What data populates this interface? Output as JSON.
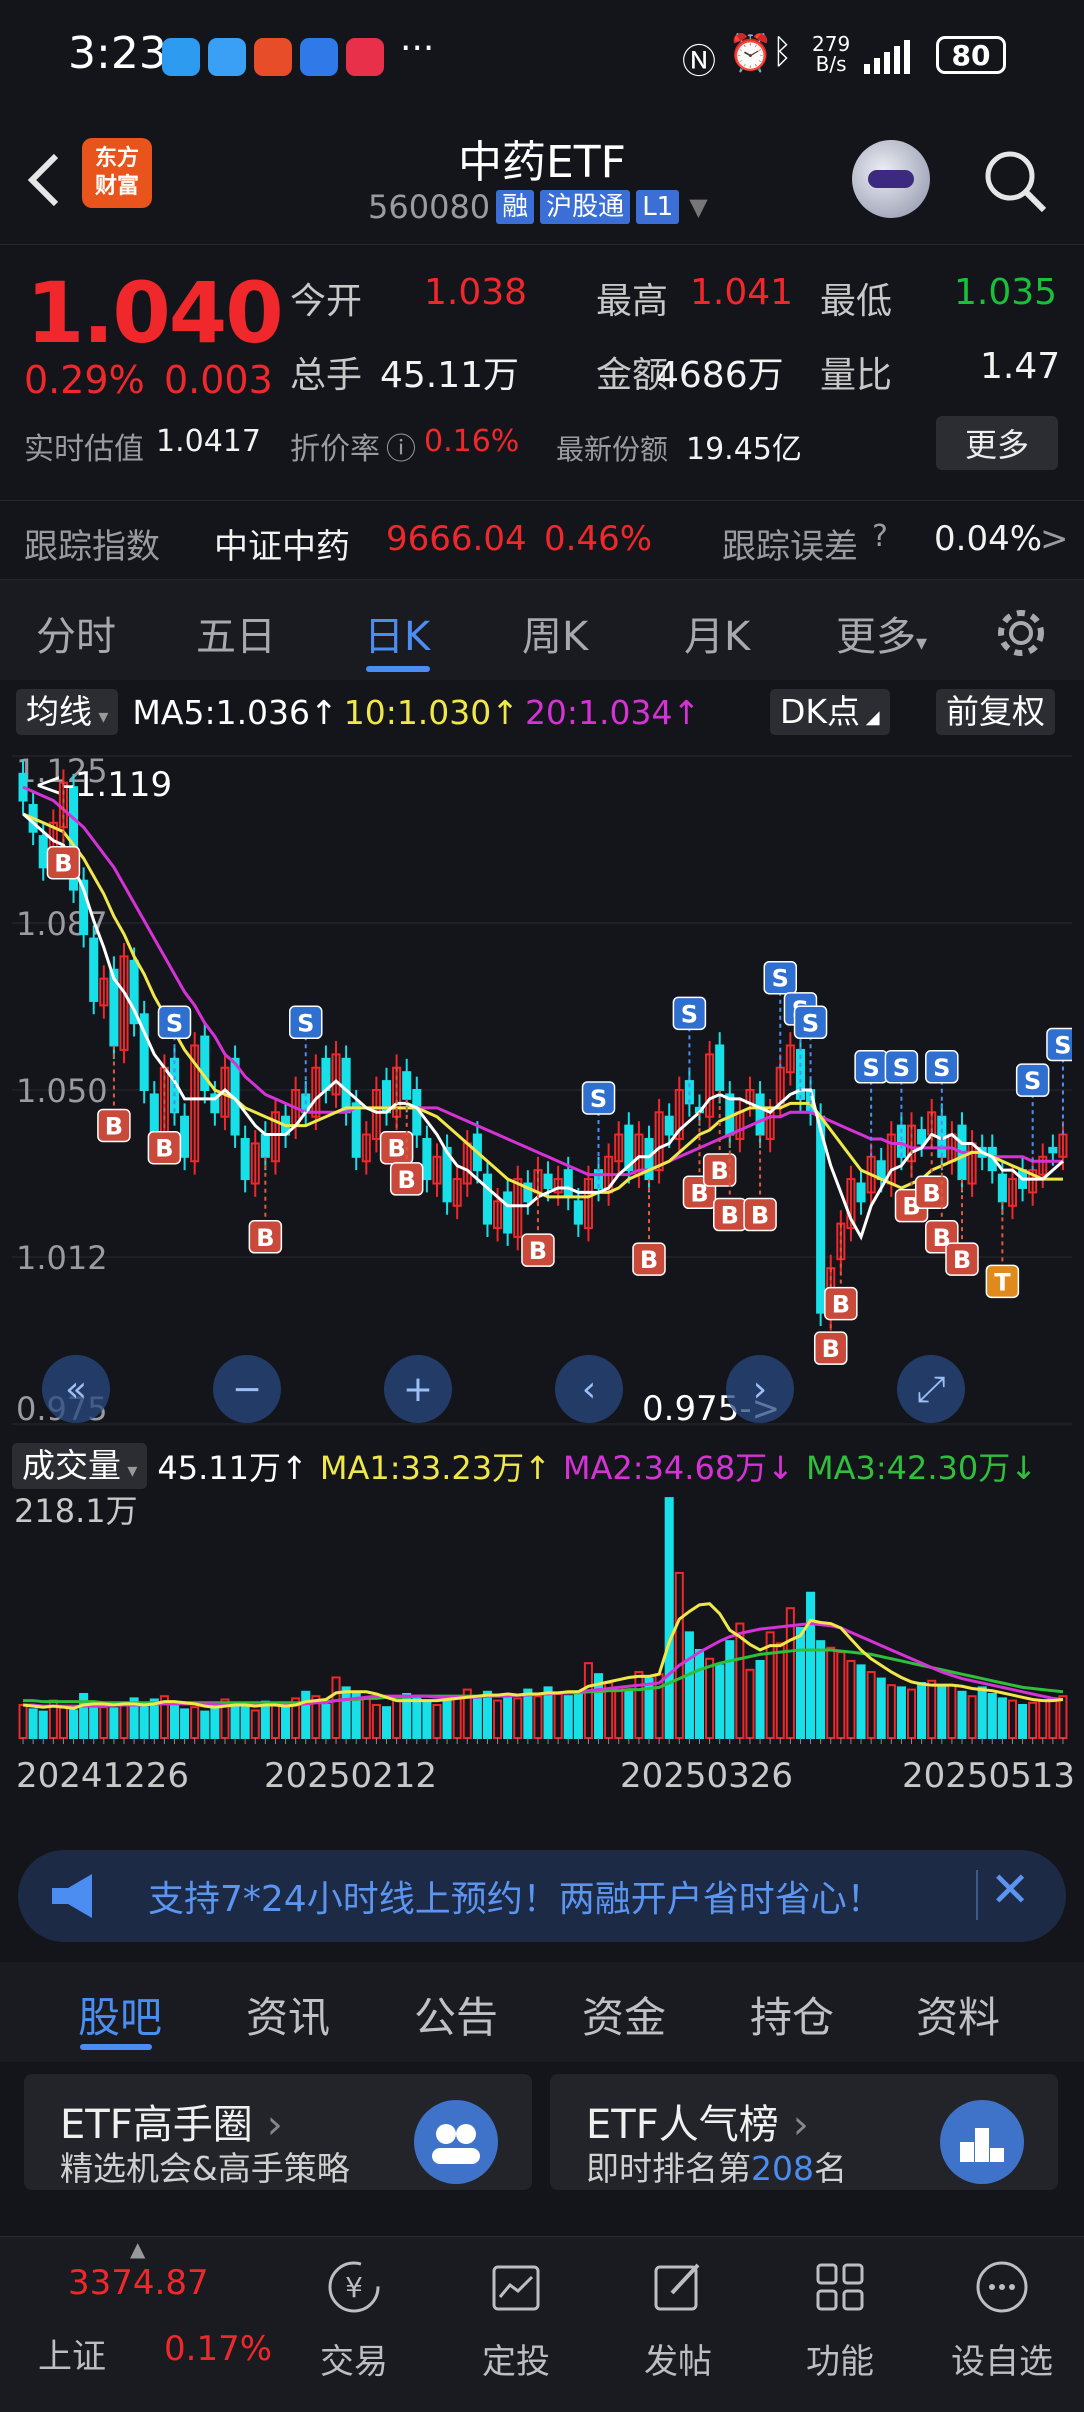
{
  "status_bar": {
    "time": "3:23",
    "net_speed_value": "279",
    "net_speed_unit": "B/s",
    "battery": "80"
  },
  "header": {
    "logo_line1": "东方",
    "logo_line2": "财富",
    "title": "中药ETF",
    "code": "560080",
    "tags": [
      "融",
      "沪股通",
      "L1"
    ]
  },
  "quote": {
    "price": "1.040",
    "change_pct": "0.29%",
    "change": "0.003",
    "open_label": "今开",
    "open": "1.038",
    "high_label": "最高",
    "high": "1.041",
    "low_label": "最低",
    "low": "1.035",
    "volume_label": "总手",
    "volume": "45.11万",
    "amount_label": "金额",
    "amount": "4686万",
    "ratio_label": "量比",
    "ratio": "1.47",
    "iopv_label": "实时估值",
    "iopv": "1.0417",
    "discount_label": "折价率",
    "discount": "0.16%",
    "shares_label": "最新份额",
    "shares": "19.45亿",
    "more_label": "更多"
  },
  "tracking": {
    "index_label": "跟踪指数",
    "index_name": "中证中药",
    "index_value": "9666.04",
    "index_change": "0.46%",
    "error_label": "跟踪误差",
    "error_value": "0.04%"
  },
  "kline_tabs": [
    "分时",
    "五日",
    "日K",
    "周K",
    "月K",
    "更多"
  ],
  "ma_row": {
    "selector": "均线",
    "ma5": "MA5:1.036↑",
    "ma10": "10:1.030↑",
    "ma20": "20:1.034↑",
    "dk_label": "DK点",
    "adjust_label": "前复权"
  },
  "vol_row": {
    "selector": "成交量",
    "vol": "45.11万↑",
    "ma1": "MA1:33.23万↑",
    "ma2": "MA2:34.68万↓",
    "ma3": "MA3:42.30万↓"
  },
  "chart_data": [
    {
      "type": "candlestick",
      "y_ticks": [
        "1.125",
        "1.087",
        "1.050",
        "1.012",
        "0.975"
      ],
      "ylim": [
        0.975,
        1.125
      ],
      "annotations": [
        "<-1.119",
        "0.975->"
      ],
      "x_ticks": [
        "20241226",
        "20250212",
        "20250326",
        "20250513"
      ],
      "close": [
        1.115,
        1.108,
        1.1,
        1.11,
        1.119,
        1.095,
        1.085,
        1.07,
        1.075,
        1.06,
        1.08,
        1.065,
        1.05,
        1.04,
        1.055,
        1.045,
        1.035,
        1.06,
        1.05,
        1.045,
        1.055,
        1.04,
        1.03,
        1.038,
        1.035,
        1.045,
        1.04,
        1.05,
        1.045,
        1.055,
        1.05,
        1.058,
        1.045,
        1.035,
        1.04,
        1.05,
        1.045,
        1.055,
        1.048,
        1.04,
        1.03,
        1.035,
        1.025,
        1.03,
        1.038,
        1.032,
        1.02,
        1.025,
        1.018,
        1.03,
        1.025,
        1.032,
        1.028,
        1.03,
        1.026,
        1.02,
        1.03,
        1.028,
        1.035,
        1.04,
        1.032,
        1.04,
        1.03,
        1.045,
        1.04,
        1.05,
        1.047,
        1.045,
        1.058,
        1.05,
        1.04,
        1.045,
        1.05,
        1.04,
        1.045,
        1.055,
        1.06,
        1.048,
        1.045,
        1.0,
        1.01,
        1.02,
        1.03,
        1.025,
        1.035,
        1.03,
        1.04,
        1.035,
        1.042,
        1.038,
        1.045,
        1.035,
        1.04,
        1.03,
        1.038,
        1.035,
        1.032,
        1.025,
        1.03,
        1.028,
        1.032,
        1.035,
        1.036,
        1.04
      ],
      "ma5": [
        1.112,
        1.11,
        1.108,
        1.106,
        1.105,
        1.1,
        1.095,
        1.088,
        1.082,
        1.075,
        1.072,
        1.068,
        1.063,
        1.058,
        1.055,
        1.052,
        1.048,
        1.048,
        1.048,
        1.048,
        1.05,
        1.048,
        1.045,
        1.042,
        1.04,
        1.04,
        1.04,
        1.042,
        1.045,
        1.048,
        1.05,
        1.052,
        1.05,
        1.048,
        1.046,
        1.045,
        1.045,
        1.047,
        1.047,
        1.046,
        1.043,
        1.04,
        1.036,
        1.033,
        1.032,
        1.03,
        1.028,
        1.026,
        1.024,
        1.024,
        1.024,
        1.026,
        1.027,
        1.028,
        1.028,
        1.027,
        1.027,
        1.027,
        1.028,
        1.031,
        1.033,
        1.035,
        1.035,
        1.037,
        1.038,
        1.041,
        1.043,
        1.045,
        1.048,
        1.049,
        1.048,
        1.048,
        1.047,
        1.046,
        1.045,
        1.047,
        1.049,
        1.05,
        1.05,
        1.041,
        1.033,
        1.027,
        1.021,
        1.017,
        1.024,
        1.028,
        1.032,
        1.033,
        1.036,
        1.037,
        1.04,
        1.039,
        1.04,
        1.038,
        1.038,
        1.036,
        1.035,
        1.032,
        1.032,
        1.03,
        1.03,
        1.03,
        1.032,
        1.034
      ],
      "ma10": [
        1.112,
        1.111,
        1.11,
        1.109,
        1.108,
        1.105,
        1.102,
        1.098,
        1.094,
        1.089,
        1.085,
        1.08,
        1.076,
        1.071,
        1.067,
        1.063,
        1.059,
        1.056,
        1.053,
        1.05,
        1.049,
        1.048,
        1.046,
        1.045,
        1.044,
        1.043,
        1.042,
        1.042,
        1.042,
        1.043,
        1.044,
        1.045,
        1.046,
        1.046,
        1.046,
        1.046,
        1.046,
        1.046,
        1.046,
        1.046,
        1.045,
        1.044,
        1.042,
        1.04,
        1.038,
        1.036,
        1.034,
        1.032,
        1.03,
        1.029,
        1.028,
        1.027,
        1.026,
        1.026,
        1.026,
        1.026,
        1.026,
        1.027,
        1.027,
        1.028,
        1.03,
        1.031,
        1.032,
        1.033,
        1.034,
        1.036,
        1.038,
        1.04,
        1.041,
        1.043,
        1.044,
        1.045,
        1.046,
        1.046,
        1.046,
        1.046,
        1.047,
        1.047,
        1.047,
        1.044,
        1.041,
        1.038,
        1.035,
        1.032,
        1.031,
        1.03,
        1.029,
        1.028,
        1.029,
        1.03,
        1.032,
        1.033,
        1.034,
        1.035,
        1.036,
        1.036,
        1.035,
        1.034,
        1.033,
        1.032,
        1.031,
        1.03,
        1.03,
        1.03
      ],
      "ma20": [
        1.118,
        1.117,
        1.116,
        1.115,
        1.113,
        1.111,
        1.109,
        1.106,
        1.103,
        1.1,
        1.096,
        1.092,
        1.088,
        1.084,
        1.08,
        1.076,
        1.072,
        1.069,
        1.065,
        1.062,
        1.058,
        1.056,
        1.053,
        1.051,
        1.049,
        1.048,
        1.047,
        1.046,
        1.045,
        1.045,
        1.045,
        1.045,
        1.045,
        1.046,
        1.046,
        1.046,
        1.046,
        1.046,
        1.046,
        1.046,
        1.046,
        1.046,
        1.045,
        1.044,
        1.043,
        1.042,
        1.041,
        1.04,
        1.039,
        1.038,
        1.037,
        1.036,
        1.035,
        1.034,
        1.033,
        1.032,
        1.031,
        1.031,
        1.031,
        1.031,
        1.031,
        1.032,
        1.032,
        1.033,
        1.034,
        1.035,
        1.036,
        1.037,
        1.038,
        1.039,
        1.04,
        1.041,
        1.042,
        1.043,
        1.044,
        1.044,
        1.045,
        1.045,
        1.045,
        1.044,
        1.043,
        1.042,
        1.041,
        1.04,
        1.039,
        1.039,
        1.038,
        1.038,
        1.037,
        1.037,
        1.037,
        1.037,
        1.037,
        1.036,
        1.036,
        1.036,
        1.035,
        1.035,
        1.035,
        1.035,
        1.034,
        1.034,
        1.034,
        1.034
      ],
      "markers_B": [
        4,
        9,
        14,
        24,
        37,
        38,
        51,
        62,
        67,
        69,
        70,
        73,
        80,
        81,
        88,
        90,
        91,
        93
      ],
      "markers_S": [
        15,
        28,
        57,
        66,
        75,
        77,
        78,
        84,
        87,
        91,
        100,
        103
      ],
      "markers_T": [
        97
      ]
    },
    {
      "type": "bar",
      "y_ticks": [
        "218.1万"
      ],
      "ylim": [
        0,
        218.1
      ],
      "values": [
        30,
        26,
        24,
        34,
        28,
        25,
        40,
        32,
        28,
        27,
        30,
        36,
        28,
        35,
        38,
        30,
        26,
        28,
        24,
        30,
        35,
        32,
        28,
        25,
        33,
        30,
        28,
        36,
        42,
        38,
        30,
        55,
        46,
        40,
        36,
        30,
        28,
        34,
        40,
        38,
        32,
        30,
        34,
        36,
        44,
        38,
        42,
        34,
        40,
        36,
        44,
        38,
        46,
        40,
        38,
        42,
        68,
        58,
        50,
        46,
        42,
        60,
        54,
        58,
        218,
        150,
        96,
        80,
        72,
        66,
        88,
        104,
        62,
        70,
        96,
        86,
        118,
        100,
        132,
        88,
        82,
        78,
        70,
        66,
        60,
        54,
        48,
        46,
        44,
        50,
        52,
        46,
        48,
        42,
        38,
        46,
        40,
        36,
        34,
        30,
        32,
        34,
        36,
        38
      ],
      "ma1": [
        30,
        29,
        28,
        29,
        28,
        27,
        30,
        31,
        31,
        30,
        31,
        31,
        30,
        31,
        33,
        33,
        32,
        31,
        29,
        28,
        29,
        30,
        30,
        29,
        30,
        30,
        29,
        30,
        33,
        34,
        35,
        41,
        42,
        42,
        42,
        40,
        37,
        34,
        34,
        34,
        34,
        34,
        35,
        36,
        37,
        38,
        39,
        39,
        40,
        39,
        40,
        40,
        41,
        41,
        42,
        42,
        47,
        49,
        51,
        53,
        55,
        56,
        56,
        58,
        87,
        108,
        115,
        121,
        122,
        113,
        98,
        92,
        85,
        80,
        84,
        84,
        89,
        93,
        107,
        105,
        104,
        100,
        90,
        80,
        72,
        66,
        60,
        55,
        51,
        49,
        48,
        48,
        48,
        47,
        45,
        44,
        43,
        41,
        39,
        37,
        35,
        34,
        34,
        35
      ],
      "ma2": [
        30,
        30,
        29,
        29,
        29,
        29,
        29,
        29,
        29,
        30,
        30,
        30,
        30,
        31,
        31,
        31,
        31,
        31,
        31,
        31,
        30,
        30,
        30,
        30,
        30,
        30,
        30,
        30,
        31,
        32,
        32,
        34,
        35,
        36,
        37,
        38,
        38,
        38,
        38,
        38,
        38,
        37,
        37,
        37,
        37,
        37,
        38,
        38,
        38,
        39,
        39,
        40,
        40,
        41,
        41,
        42,
        43,
        44,
        45,
        46,
        47,
        48,
        49,
        50,
        58,
        66,
        72,
        78,
        83,
        88,
        92,
        95,
        97,
        99,
        100,
        101,
        102,
        103,
        104,
        103,
        102,
        100,
        96,
        92,
        88,
        84,
        80,
        76,
        72,
        68,
        64,
        60,
        57,
        54,
        52,
        50,
        48,
        46,
        44,
        42,
        40,
        38,
        36,
        35
      ],
      "ma3": [
        34,
        34,
        33,
        33,
        33,
        33,
        33,
        33,
        32,
        32,
        32,
        32,
        32,
        32,
        32,
        32,
        32,
        32,
        32,
        32,
        32,
        32,
        32,
        32,
        32,
        32,
        32,
        32,
        32,
        33,
        33,
        34,
        35,
        35,
        36,
        36,
        37,
        37,
        37,
        38,
        38,
        38,
        38,
        38,
        38,
        38,
        39,
        39,
        39,
        39,
        40,
        40,
        40,
        41,
        41,
        41,
        42,
        42,
        43,
        43,
        44,
        44,
        45,
        46,
        50,
        54,
        58,
        62,
        65,
        68,
        70,
        72,
        74,
        76,
        77,
        78,
        79,
        80,
        80,
        80,
        80,
        79,
        78,
        77,
        76,
        74,
        72,
        70,
        68,
        66,
        64,
        62,
        60,
        58,
        56,
        54,
        52,
        50,
        48,
        46,
        45,
        44,
        43,
        42
      ]
    }
  ],
  "chart_controls": [
    "«",
    "−",
    "+",
    "‹",
    "›",
    "⤢"
  ],
  "banner": {
    "text": "支持7*24小时线上预约！两融开户省时省心！"
  },
  "info_tabs": [
    "股吧",
    "资讯",
    "公告",
    "资金",
    "持仓",
    "资料"
  ],
  "cards": [
    {
      "title": "ETF高手圈",
      "subtitle": "精选机会&高手策略"
    },
    {
      "title": "ETF人气榜",
      "subtitle_pre": "即时排名第",
      "subtitle_num": "208",
      "subtitle_post": "名"
    }
  ],
  "nav": {
    "index_value": "3374.87",
    "index_name": "上证",
    "index_change": "0.17%",
    "items": [
      "交易",
      "定投",
      "发帖",
      "功能",
      "设自选"
    ]
  },
  "colors": {
    "up": "#f0282b",
    "down": "#17e0e8",
    "ma5": "#ffffff",
    "ma10": "#f0e84a",
    "ma20": "#d633d6",
    "vol_ma1": "#f0e84a",
    "vol_ma2": "#d633d6",
    "vol_ma3": "#2fbf3a",
    "accent": "#4b8df0"
  }
}
